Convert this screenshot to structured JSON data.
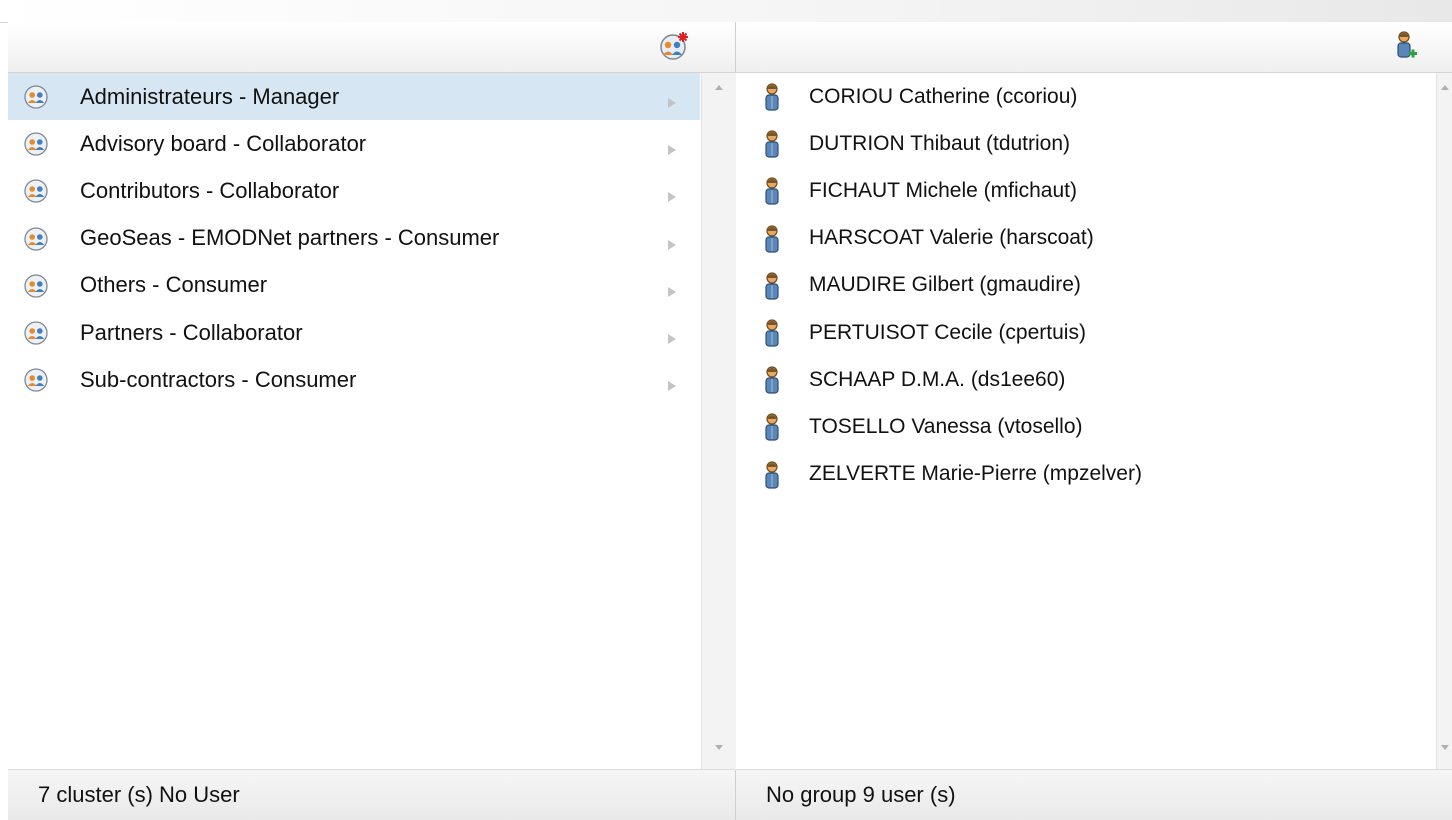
{
  "clusters_panel": {
    "toolbar": {
      "add_cluster_icon": "group-add-icon"
    },
    "items": [
      {
        "label": "Administrateurs - Manager",
        "icon": "group-icon",
        "selected": true
      },
      {
        "label": "Advisory board - Collaborator",
        "icon": "group-icon",
        "selected": false
      },
      {
        "label": "Contributors - Collaborator",
        "icon": "group-icon",
        "selected": false
      },
      {
        "label": "GeoSeas - EMODNet partners - Consumer",
        "icon": "group-icon",
        "selected": false
      },
      {
        "label": "Others - Consumer",
        "icon": "group-icon",
        "selected": false
      },
      {
        "label": "Partners - Collaborator",
        "icon": "group-icon",
        "selected": false
      },
      {
        "label": "Sub-contractors - Consumer",
        "icon": "group-icon",
        "selected": false
      }
    ],
    "status": "7 cluster (s) No User"
  },
  "users_panel": {
    "toolbar": {
      "add_user_icon": "user-add-icon"
    },
    "items": [
      {
        "label": "CORIOU Catherine (ccoriou)",
        "icon": "user-icon"
      },
      {
        "label": "DUTRION Thibaut (tdutrion)",
        "icon": "user-icon"
      },
      {
        "label": "FICHAUT Michele (mfichaut)",
        "icon": "user-icon"
      },
      {
        "label": "HARSCOAT Valerie (harscoat)",
        "icon": "user-icon"
      },
      {
        "label": "MAUDIRE Gilbert (gmaudire)",
        "icon": "user-icon"
      },
      {
        "label": "PERTUISOT Cecile (cpertuis)",
        "icon": "user-icon"
      },
      {
        "label": "SCHAAP D.M.A. (ds1ee60)",
        "icon": "user-icon"
      },
      {
        "label": "TOSELLO Vanessa (vtosello)",
        "icon": "user-icon"
      },
      {
        "label": "ZELVERTE Marie-Pierre (mpzelver)",
        "icon": "user-icon"
      }
    ],
    "status": "No group 9 user (s)"
  },
  "colors": {
    "selection": "#d7e6f3",
    "group_icon_orange": "#e8892b",
    "user_icon_blue": "#2f5f8f"
  }
}
